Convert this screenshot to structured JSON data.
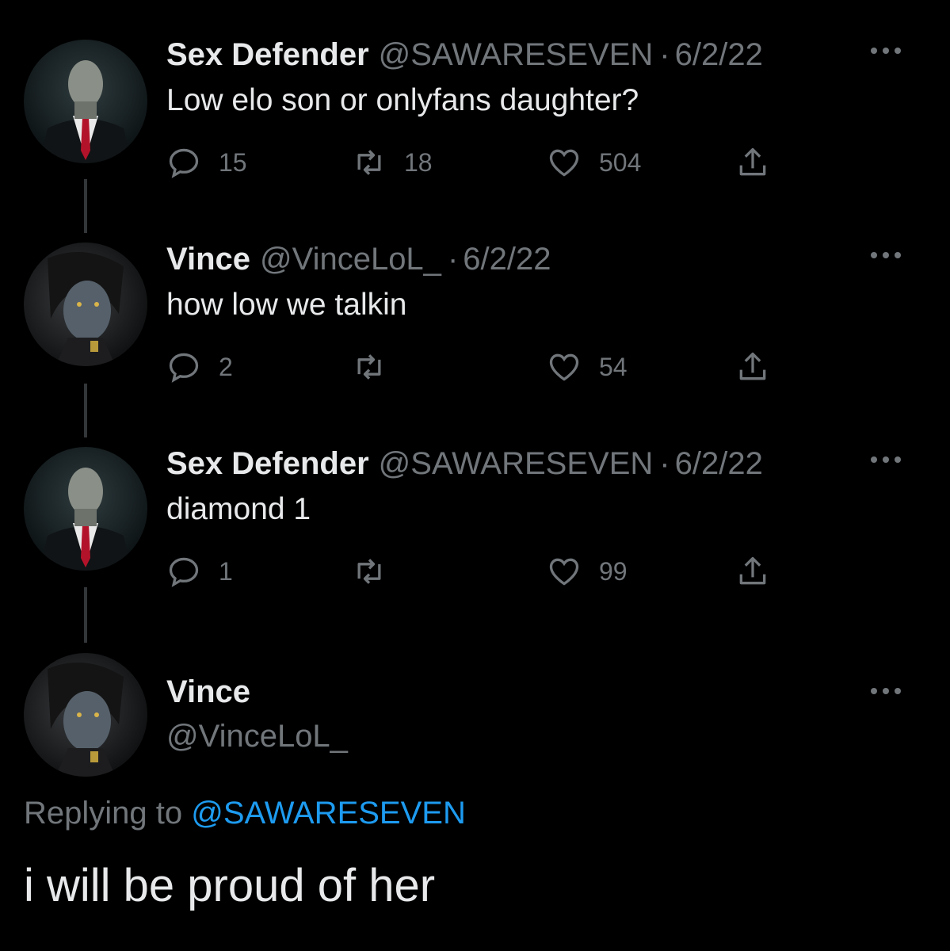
{
  "colors": {
    "background": "#000000",
    "text_primary": "#e7e9ea",
    "text_secondary": "#71767b",
    "link": "#1d9bf0",
    "thread_line": "#333639"
  },
  "tweets": [
    {
      "name": "Sex Defender",
      "handle": "@SAWARESEVEN",
      "separator": "·",
      "date": "6/2/22",
      "text": "Low elo son or onlyfans daughter?",
      "replies": "15",
      "retweets": "18",
      "likes": "504",
      "avatar_icon": "masked-man-in-suit-avatar"
    },
    {
      "name": "Vince",
      "handle": "@VinceLoL_",
      "separator": "·",
      "date": "6/2/22",
      "text": "how low we talkin",
      "replies": "2",
      "retweets": "",
      "likes": "54",
      "avatar_icon": "dark-haired-character-avatar"
    },
    {
      "name": "Sex Defender",
      "handle": "@SAWARESEVEN",
      "separator": "·",
      "date": "6/2/22",
      "text": "diamond 1",
      "replies": "1",
      "retweets": "",
      "likes": "99",
      "avatar_icon": "masked-man-in-suit-avatar"
    }
  ],
  "main_tweet": {
    "name": "Vince",
    "handle": "@VinceLoL_",
    "replying_prefix": "Replying to",
    "replying_to": "@SAWARESEVEN",
    "text": "i will be proud of her",
    "avatar_icon": "dark-haired-character-avatar"
  },
  "icons": {
    "reply": "reply-bubble-icon",
    "retweet": "retweet-icon",
    "like": "heart-icon",
    "share": "share-upload-icon",
    "more": "more-dots-icon"
  }
}
